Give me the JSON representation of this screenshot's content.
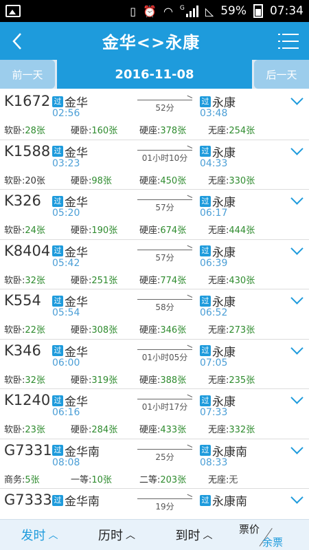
{
  "status_bar": {
    "network": "G",
    "battery": "59%",
    "time": "07:34"
  },
  "header": {
    "title": "金华<>永康"
  },
  "date_bar": {
    "prev": "前一天",
    "date": "2016-11-08",
    "next": "后一天"
  },
  "trains": [
    {
      "code": "K1672",
      "tag": "过",
      "from": "金华",
      "dep": "02:56",
      "duration": "52分",
      "to": "永康",
      "arr": "03:48",
      "seats": [
        {
          "label": "软卧:",
          "count": "28张"
        },
        {
          "label": "硬卧:",
          "count": "160张"
        },
        {
          "label": "硬座:",
          "count": "378张"
        },
        {
          "label": "无座:",
          "count": "254张"
        }
      ]
    },
    {
      "code": "K1588",
      "tag": "过",
      "from": "金华",
      "dep": "03:23",
      "duration": "01小时10分",
      "to": "永康",
      "arr": "04:33",
      "seats": [
        {
          "label": "软卧:",
          "count": "20张"
        },
        {
          "label": "硬卧:",
          "count": "98张"
        },
        {
          "label": "硬座:",
          "count": "450张"
        },
        {
          "label": "无座:",
          "count": "330张"
        }
      ]
    },
    {
      "code": "K326",
      "tag": "过",
      "from": "金华",
      "dep": "05:20",
      "duration": "57分",
      "to": "永康",
      "arr": "06:17",
      "seats": [
        {
          "label": "软卧:",
          "count": "24张"
        },
        {
          "label": "硬卧:",
          "count": "190张"
        },
        {
          "label": "硬座:",
          "count": "674张"
        },
        {
          "label": "无座:",
          "count": "444张"
        }
      ]
    },
    {
      "code": "K8404",
      "tag": "过",
      "from": "金华",
      "dep": "05:42",
      "duration": "57分",
      "to": "永康",
      "arr": "06:39",
      "seats": [
        {
          "label": "软卧:",
          "count": "32张"
        },
        {
          "label": "硬卧:",
          "count": "251张"
        },
        {
          "label": "硬座:",
          "count": "774张"
        },
        {
          "label": "无座:",
          "count": "430张"
        }
      ]
    },
    {
      "code": "K554",
      "tag": "过",
      "from": "金华",
      "dep": "05:54",
      "duration": "58分",
      "to": "永康",
      "arr": "06:52",
      "seats": [
        {
          "label": "软卧:",
          "count": "22张"
        },
        {
          "label": "硬卧:",
          "count": "308张"
        },
        {
          "label": "硬座:",
          "count": "346张"
        },
        {
          "label": "无座:",
          "count": "273张"
        }
      ]
    },
    {
      "code": "K346",
      "tag": "过",
      "from": "金华",
      "dep": "06:00",
      "duration": "01小时05分",
      "to": "永康",
      "arr": "07:05",
      "seats": [
        {
          "label": "软卧:",
          "count": "32张"
        },
        {
          "label": "硬卧:",
          "count": "319张"
        },
        {
          "label": "硬座:",
          "count": "388张"
        },
        {
          "label": "无座:",
          "count": "235张"
        }
      ]
    },
    {
      "code": "K1240",
      "tag": "过",
      "from": "金华",
      "dep": "06:16",
      "duration": "01小时17分",
      "to": "永康",
      "arr": "07:33",
      "seats": [
        {
          "label": "软卧:",
          "count": "23张"
        },
        {
          "label": "硬卧:",
          "count": "284张"
        },
        {
          "label": "硬座:",
          "count": "433张"
        },
        {
          "label": "无座:",
          "count": "332张"
        }
      ]
    },
    {
      "code": "G7331",
      "tag": "过",
      "from": "金华南",
      "dep": "08:08",
      "duration": "25分",
      "to": "永康南",
      "arr": "08:33",
      "seats": [
        {
          "label": "商务:",
          "count": "5张"
        },
        {
          "label": "一等:",
          "count": "10张"
        },
        {
          "label": "二等:",
          "count": "203张"
        },
        {
          "label": "无座:",
          "count": "无"
        }
      ]
    },
    {
      "code": "G7333",
      "tag": "过",
      "from": "金华南",
      "dep": "",
      "duration": "19分",
      "to": "永康南",
      "arr": "",
      "seats": []
    }
  ],
  "bottom_bar": {
    "depart": "发时",
    "travel": "历时",
    "arrive": "到时",
    "price": "票价",
    "remaining": "余票",
    "caret": "^"
  },
  "colors": {
    "primary": "#1e9bdc",
    "count_green": "#2e8b2e",
    "time_blue": "#4a9ed6"
  }
}
